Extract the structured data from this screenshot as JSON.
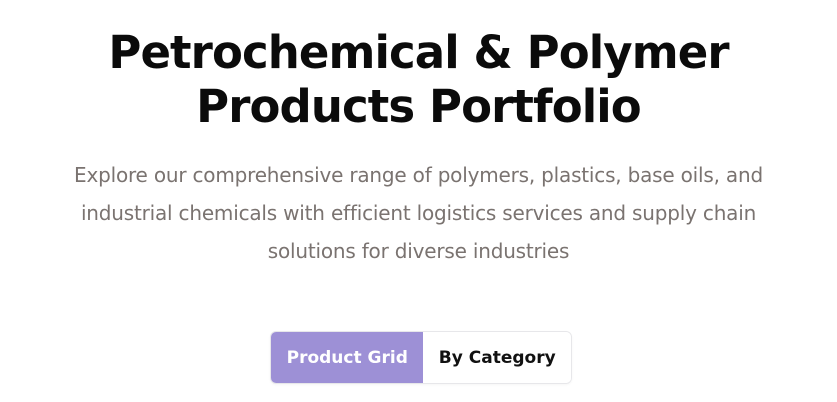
{
  "hero": {
    "title": "Petrochemical & Polymer Products Portfolio",
    "description": "Explore our comprehensive range of polymers, plastics, base oils, and industrial chemicals with efficient logistics services and supply chain solutions for diverse industries"
  },
  "view_toggle": {
    "options": [
      {
        "label": "Product Grid",
        "active": true
      },
      {
        "label": "By Category",
        "active": false
      }
    ],
    "active_color": "#9d90d6"
  }
}
